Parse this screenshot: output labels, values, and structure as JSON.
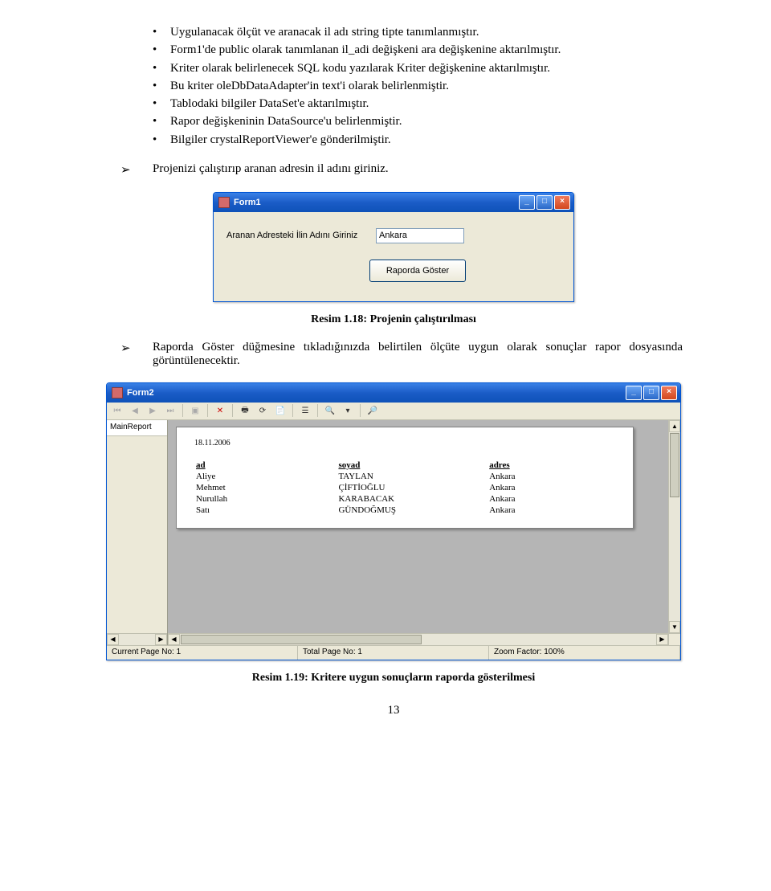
{
  "bullets": [
    "Uygulanacak ölçüt ve aranacak il adı string tipte tanımlanmıştır.",
    "Form1'de public olarak tanımlanan il_adi değişkeni ara değişkenine aktarılmıştır.",
    "Kriter olarak belirlenecek SQL kodu yazılarak Kriter değişkenine aktarılmıştır.",
    "Bu kriter oleDbDataAdapter'in text'i olarak belirlenmiştir.",
    "Tablodaki bilgiler DataSet'e aktarılmıştır.",
    "Rapor değişkeninin DataSource'u belirlenmiştir.",
    "Bilgiler crystalReportViewer'e gönderilmiştir."
  ],
  "arrow1": "Projenizi çalıştırıp aranan adresin il adını giriniz.",
  "form1": {
    "title": "Form1",
    "label": "Aranan Adresteki İlin Adını Giriniz",
    "input_value": "Ankara",
    "button": "Raporda Göster"
  },
  "caption1": "Resim 1.18: Projenin çalıştırılması",
  "arrow2": "Raporda Göster düğmesine tıkladığınızda belirtilen ölçüte uygun olarak sonuçlar rapor dosyasında görüntülenecektir.",
  "form2": {
    "title": "Form2",
    "tab": "MainReport",
    "date": "18.11.2006",
    "headers": {
      "ad": "ad",
      "soyad": "soyad",
      "adres": "adres"
    },
    "rows": [
      {
        "ad": "Aliye",
        "soyad": "TAYLAN",
        "adres": "Ankara"
      },
      {
        "ad": "Mehmet",
        "soyad": "ÇİFTİOĞLU",
        "adres": "Ankara"
      },
      {
        "ad": "Nurullah",
        "soyad": "KARABACAK",
        "adres": "Ankara"
      },
      {
        "ad": "Satı",
        "soyad": "GÜNDOĞMUŞ",
        "adres": "Ankara"
      }
    ],
    "status": {
      "current_page": "Current Page No: 1",
      "total_page": "Total Page No: 1",
      "zoom": "Zoom Factor: 100%"
    }
  },
  "caption2": "Resim 1.19: Kritere uygun sonuçların raporda gösterilmesi",
  "page_number": "13"
}
